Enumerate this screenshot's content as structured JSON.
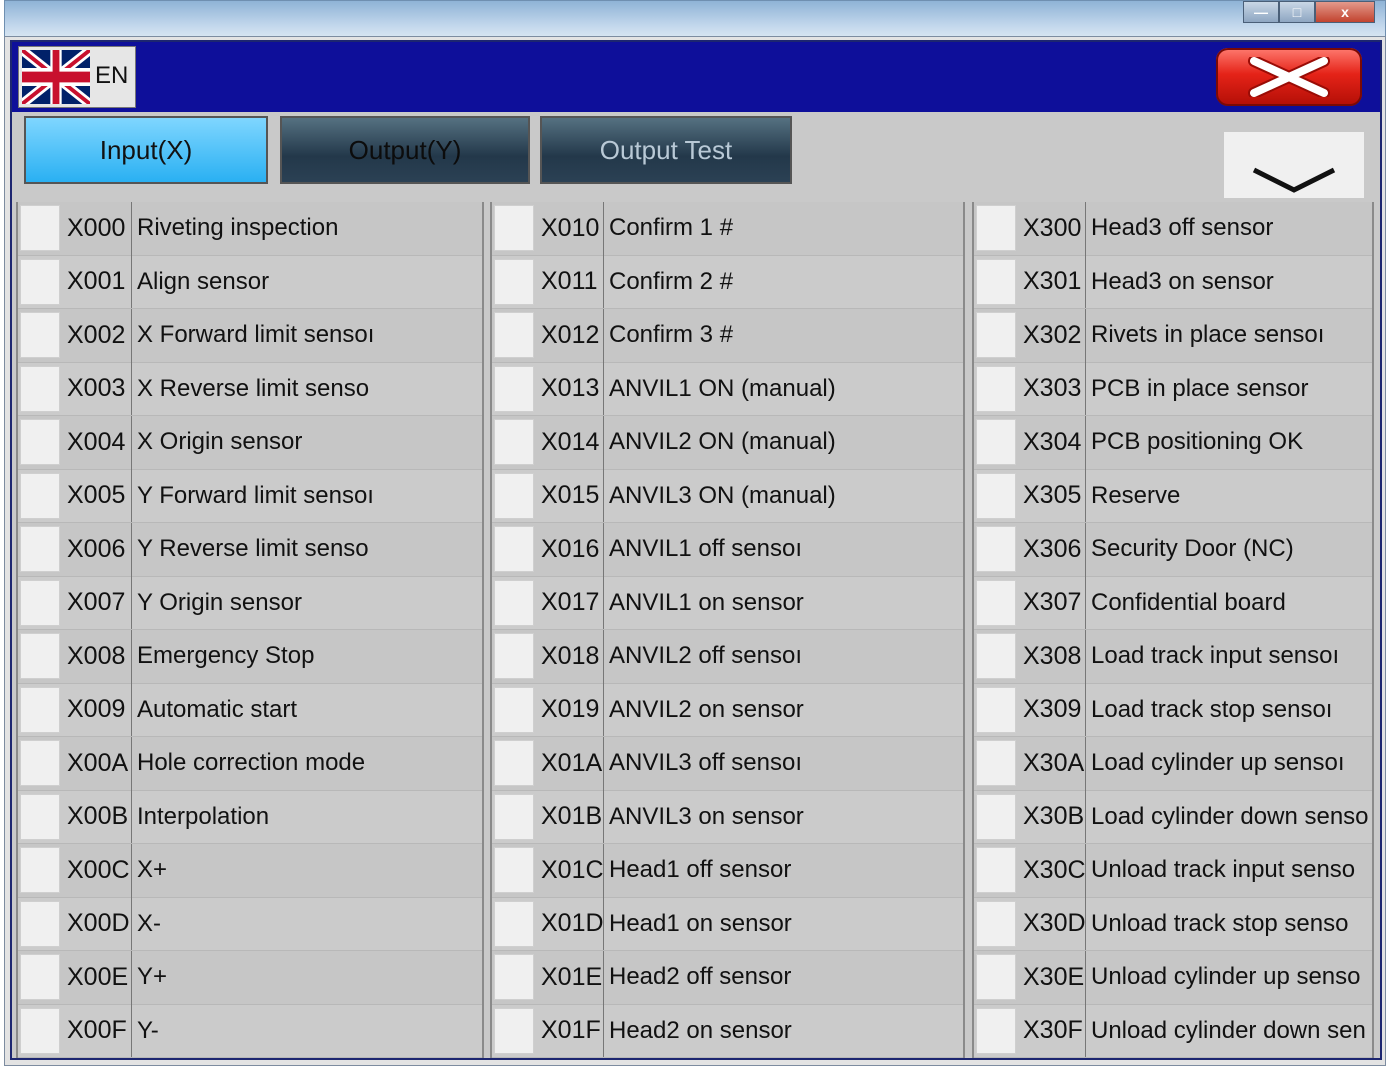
{
  "window": {
    "close_glyph": "x"
  },
  "header": {
    "language_code": "EN"
  },
  "tabs": [
    {
      "label": "Input(X)",
      "active": true
    },
    {
      "label": "Output(Y)",
      "active": false
    },
    {
      "label": "Output Test",
      "active": false
    }
  ],
  "colors": {
    "header_bg": "#0e0f9a",
    "active_tab": "#2ab0f2",
    "close_button": "#e52318"
  },
  "columns": [
    {
      "rows": [
        {
          "addr": "X000",
          "desc": "Riveting inspection"
        },
        {
          "addr": "X001",
          "desc": "Align sensor"
        },
        {
          "addr": "X002",
          "desc": "X Forward limit sensoı"
        },
        {
          "addr": "X003",
          "desc": "X Reverse limit senso"
        },
        {
          "addr": "X004",
          "desc": "X Origin sensor"
        },
        {
          "addr": "X005",
          "desc": "Y Forward limit sensoı"
        },
        {
          "addr": "X006",
          "desc": "Y Reverse limit senso"
        },
        {
          "addr": "X007",
          "desc": "Y Origin sensor"
        },
        {
          "addr": "X008",
          "desc": "Emergency Stop"
        },
        {
          "addr": "X009",
          "desc": "Automatic start"
        },
        {
          "addr": "X00A",
          "desc": "Hole correction mode"
        },
        {
          "addr": "X00B",
          "desc": "Interpolation"
        },
        {
          "addr": "X00C",
          "desc": "X+"
        },
        {
          "addr": "X00D",
          "desc": "X-"
        },
        {
          "addr": "X00E",
          "desc": "Y+"
        },
        {
          "addr": "X00F",
          "desc": "Y-"
        }
      ]
    },
    {
      "rows": [
        {
          "addr": "X010",
          "desc": "Confirm 1 #"
        },
        {
          "addr": "X011",
          "desc": "Confirm 2 #"
        },
        {
          "addr": "X012",
          "desc": "Confirm 3 #"
        },
        {
          "addr": "X013",
          "desc": "ANVIL1 ON (manual)"
        },
        {
          "addr": "X014",
          "desc": "ANVIL2 ON (manual)"
        },
        {
          "addr": "X015",
          "desc": "ANVIL3 ON (manual)"
        },
        {
          "addr": "X016",
          "desc": "ANVIL1 off sensoı"
        },
        {
          "addr": "X017",
          "desc": "ANVIL1 on sensor"
        },
        {
          "addr": "X018",
          "desc": "ANVIL2 off sensoı"
        },
        {
          "addr": "X019",
          "desc": "ANVIL2 on sensor"
        },
        {
          "addr": "X01A",
          "desc": "ANVIL3 off sensoı"
        },
        {
          "addr": "X01B",
          "desc": "ANVIL3 on sensor"
        },
        {
          "addr": "X01C",
          "desc": "Head1 off sensor"
        },
        {
          "addr": "X01D",
          "desc": "Head1 on sensor"
        },
        {
          "addr": "X01E",
          "desc": "Head2 off sensor"
        },
        {
          "addr": "X01F",
          "desc": "Head2 on sensor"
        }
      ]
    },
    {
      "rows": [
        {
          "addr": "X300",
          "desc": "Head3 off sensor"
        },
        {
          "addr": "X301",
          "desc": "Head3 on sensor"
        },
        {
          "addr": "X302",
          "desc": "Rivets in place sensoı"
        },
        {
          "addr": "X303",
          "desc": "PCB in place sensor"
        },
        {
          "addr": "X304",
          "desc": "PCB positioning OK"
        },
        {
          "addr": "X305",
          "desc": "Reserve"
        },
        {
          "addr": "X306",
          "desc": "Security Door (NC)"
        },
        {
          "addr": "X307",
          "desc": "Confidential board"
        },
        {
          "addr": "X308",
          "desc": "Load track input sensoı"
        },
        {
          "addr": "X309",
          "desc": "Load track stop sensoı"
        },
        {
          "addr": "X30A",
          "desc": "Load cylinder up sensoı"
        },
        {
          "addr": "X30B",
          "desc": "Load cylinder down senso"
        },
        {
          "addr": "X30C",
          "desc": "Unload track input senso"
        },
        {
          "addr": "X30D",
          "desc": "Unload track stop senso"
        },
        {
          "addr": "X30E",
          "desc": "Unload cylinder up senso"
        },
        {
          "addr": "X30F",
          "desc": "Unload cylinder down sen"
        }
      ]
    }
  ]
}
